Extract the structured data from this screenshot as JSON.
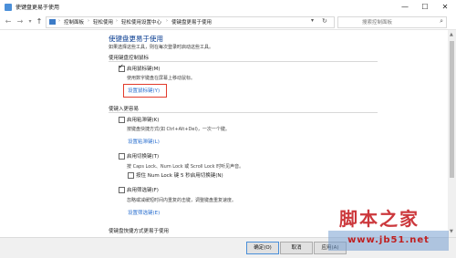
{
  "window": {
    "title": "使键盘更易于使用",
    "min_glyph": "—",
    "max_glyph": "☐",
    "close_glyph": "✕"
  },
  "address_bar": {
    "breadcrumbs": [
      "控制面板",
      "轻松使用",
      "轻松使用设置中心",
      "使键盘更易于使用"
    ],
    "separator": "›",
    "search_placeholder": "搜索控制面板"
  },
  "page": {
    "heading": "使键盘更易于使用",
    "subtitle": "如果选择这些工具，则在每次登录时启动这些工具。",
    "sections": {
      "mouse_keys": {
        "header": "使用键盘控制鼠标",
        "checkbox_label": "启用鼠标键(M)",
        "checked": true,
        "description": "使用数字键盘在屏幕上移动鼠标。",
        "link": "设置鼠标键(Y)"
      },
      "typing": {
        "header": "使键入更容易",
        "sticky_label": "启用粘滞键(K)",
        "sticky_checked": false,
        "sticky_desc": "按键盘快捷方式(如 Ctrl+Alt+Del)，一次一个键。",
        "sticky_link": "设置粘滞键(L)",
        "toggle_label": "启用切换键(T)",
        "toggle_checked": false,
        "toggle_desc": "按 Caps Lock、Num Lock 或 Scroll Lock 时听见声音。",
        "toggle_sub_label": "按住 Num Lock 键 5 秒启用切换键(N)",
        "toggle_sub_checked": false,
        "filter_label": "启用筛选键(F)",
        "filter_checked": false,
        "filter_desc": "忽略或减缓短时间内重复的击键，调整键盘重复速度。",
        "filter_link": "设置筛选键(E)"
      },
      "shortcuts": {
        "header": "使键盘快捷方式更易于使用"
      }
    }
  },
  "buttons": {
    "ok": "确定(O)",
    "cancel": "取消",
    "apply": "应用(A)"
  },
  "watermark": {
    "line1": "脚本之家",
    "line2": "www.jb51.net"
  },
  "colors": {
    "heading": "#0a3d91",
    "link": "#2a6fcf",
    "highlight_box": "#e23b2b"
  }
}
